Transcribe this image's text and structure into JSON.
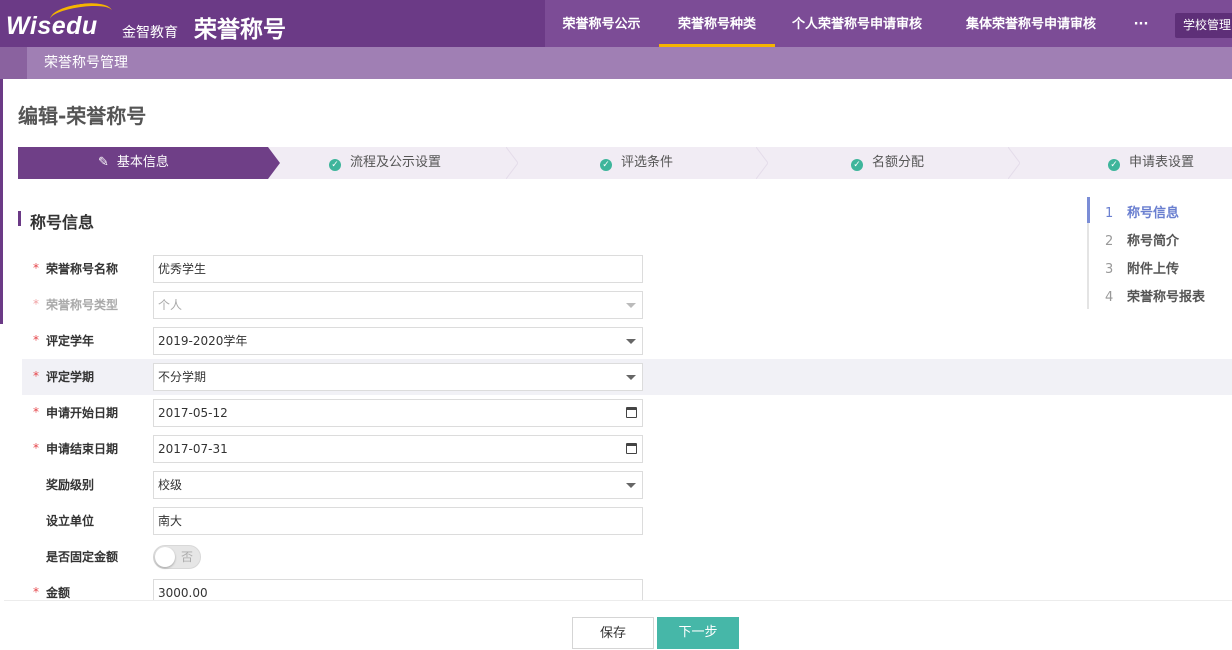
{
  "header": {
    "logo_text": "Wisedu",
    "brand_cn": "金智教育",
    "app_title": "荣誉称号",
    "nav": [
      {
        "label": "荣誉称号公示"
      },
      {
        "label": "荣誉称号种类"
      },
      {
        "label": "个人荣誉称号申请审核"
      },
      {
        "label": "集体荣誉称号申请审核"
      },
      {
        "label": "···"
      }
    ],
    "active_nav": "荣誉称号种类",
    "role_button": "学校管理员"
  },
  "subheader": {
    "label": "荣誉称号管理"
  },
  "page": {
    "title": "编辑-荣誉称号"
  },
  "steps": [
    {
      "label": "基本信息",
      "state": "active"
    },
    {
      "label": "流程及公示设置",
      "state": "done"
    },
    {
      "label": "评选条件",
      "state": "done"
    },
    {
      "label": "名额分配",
      "state": "done"
    },
    {
      "label": "申请表设置",
      "state": "done"
    }
  ],
  "section": {
    "title": "称号信息"
  },
  "form": [
    {
      "label": "荣誉称号名称",
      "required": true,
      "type": "text",
      "value": "优秀学生"
    },
    {
      "label": "荣誉称号类型",
      "required": true,
      "type": "select",
      "value": "个人",
      "disabled": true
    },
    {
      "label": "评定学年",
      "required": true,
      "type": "select",
      "value": "2019-2020学年"
    },
    {
      "label": "评定学期",
      "required": true,
      "type": "select",
      "value": "不分学期"
    },
    {
      "label": "申请开始日期",
      "required": true,
      "type": "date",
      "value": "2017-05-12"
    },
    {
      "label": "申请结束日期",
      "required": true,
      "type": "date",
      "value": "2017-07-31"
    },
    {
      "label": "奖励级别",
      "required": false,
      "type": "select",
      "value": "校级"
    },
    {
      "label": "设立单位",
      "required": false,
      "type": "text",
      "value": "南大"
    },
    {
      "label": "是否固定金额",
      "required": false,
      "type": "toggle",
      "value": "否"
    },
    {
      "label": "金额",
      "required": true,
      "type": "text",
      "value": "3000.00"
    }
  ],
  "required_mark": "*",
  "anchor_nav": [
    {
      "num": "1",
      "label": "称号信息",
      "active": true
    },
    {
      "num": "2",
      "label": "称号简介"
    },
    {
      "num": "3",
      "label": "附件上传"
    },
    {
      "num": "4",
      "label": "荣誉称号报表"
    }
  ],
  "footer": {
    "save": "保存",
    "next": "下一步"
  },
  "colors": {
    "brand_purple": "#6b3a86",
    "accent_yellow": "#f5b400",
    "teal": "#46b7a8",
    "anchor_blue": "#6a7fd0"
  }
}
